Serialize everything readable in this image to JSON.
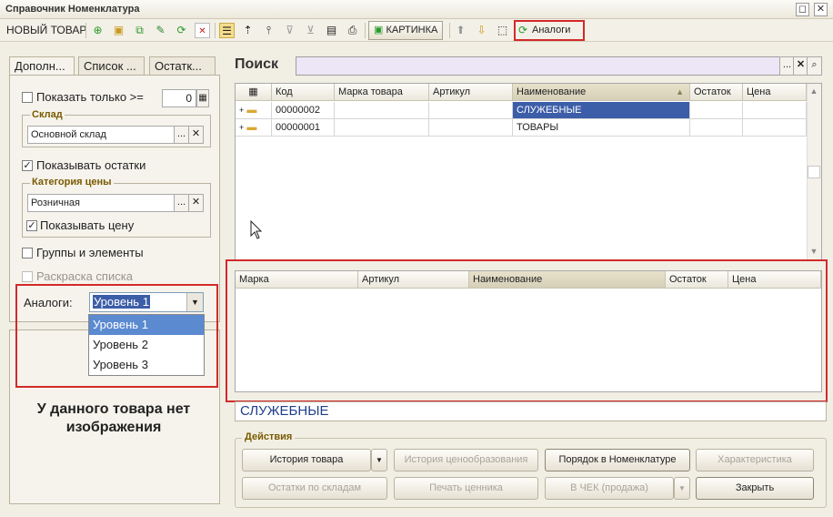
{
  "window": {
    "title": "Справочник Номенклатура",
    "restore_glyph": "◻",
    "close_glyph": "✕"
  },
  "toolbar": {
    "new_item": "НОВЫЙ ТОВАР",
    "picture": "КАРТИНКА",
    "analogs": "Аналоги"
  },
  "tabs": [
    "Дополн...",
    "Список ...",
    "Остатк..."
  ],
  "left": {
    "show_only_label": "Показать только  >=",
    "show_only_value": "0",
    "warehouse_group": "Склад",
    "warehouse_value": "Основной склад",
    "show_stock": "Показывать остатки",
    "price_group": "Категория цены",
    "price_value": "Розничная",
    "show_price": "Показывать цену",
    "groups_elements": "Группы и элементы",
    "coloring": "Раскраска списка",
    "analogs_label": "Аналоги:",
    "analogs_selected": "Уровень 1",
    "analogs_options": [
      "Уровень 1",
      "Уровень 2",
      "Уровень 3"
    ],
    "no_image": "У данного товара нет изображения"
  },
  "search": {
    "label": "Поиск",
    "value": ""
  },
  "main_grid": {
    "columns": [
      "Код",
      "Марка товара",
      "Артикул",
      "Наименование",
      "Остаток",
      "Цена"
    ],
    "rows": [
      {
        "code": "00000002",
        "brand": "",
        "article": "",
        "name": "СЛУЖЕБНЫЕ",
        "stock": "",
        "price": ""
      },
      {
        "code": "00000001",
        "brand": "",
        "article": "",
        "name": "ТОВАРЫ",
        "stock": "",
        "price": ""
      }
    ]
  },
  "analog_grid": {
    "columns": [
      "Марка",
      "Артикул",
      "Наименование",
      "Остаток",
      "Цена"
    ]
  },
  "current_item": "СЛУЖЕБНЫЕ",
  "actions": {
    "title": "Действия",
    "history": "История товара",
    "price_history": "История ценообразования",
    "order": "Порядок в Номенклатуре",
    "characteristic": "Характеристика",
    "stock_by_wh": "Остатки по складам",
    "print_label": "Печать ценника",
    "to_check": "В ЧЕК (продажа)",
    "close": "Закрыть"
  }
}
